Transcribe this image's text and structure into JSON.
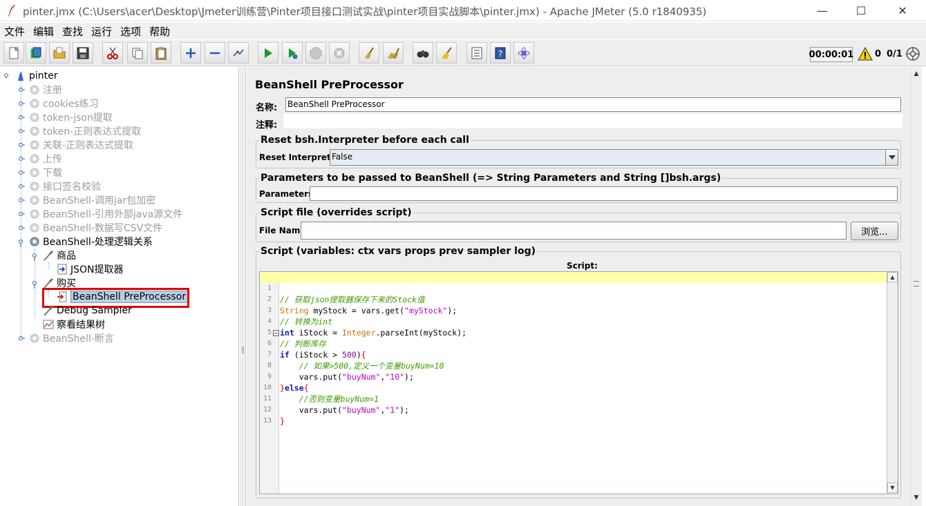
{
  "window": {
    "title": "pinter.jmx (C:\\Users\\acer\\Desktop\\Jmeter训练营\\Pinter项目接口测试实战\\pinter项目实战脚本\\pinter.jmx) - Apache JMeter (5.0 r1840935)",
    "minimize": "—",
    "maximize": "☐",
    "close": "✕"
  },
  "menu": [
    "文件",
    "编辑",
    "查找",
    "运行",
    "选项",
    "帮助"
  ],
  "toolbar": {
    "buttons": [
      "new-icon",
      "templates-icon",
      "open-icon",
      "save-icon",
      "cut-icon",
      "copy-icon",
      "paste-icon",
      "expand-icon",
      "collapse-icon",
      "toggle-icon",
      "start-icon",
      "start-no-pauses-icon",
      "stop-icon",
      "shutdown-icon",
      "clear-icon",
      "clear-all-icon",
      "search-icon",
      "reset-search-icon",
      "function-helper-icon",
      "help-icon",
      "log-viewer-icon"
    ],
    "timer": "00:00:01",
    "warnings": "0",
    "threads": "0/1"
  },
  "tree": {
    "root": "pinter",
    "items": [
      {
        "label": "注册",
        "disabled": true
      },
      {
        "label": "cookies练习",
        "disabled": true
      },
      {
        "label": "token-json提取",
        "disabled": true
      },
      {
        "label": "token-正则表达式提取",
        "disabled": true
      },
      {
        "label": "关联-正则表达式提取",
        "disabled": true
      },
      {
        "label": "上传",
        "disabled": true
      },
      {
        "label": "下载",
        "disabled": true
      },
      {
        "label": "接口签名校验",
        "disabled": true
      },
      {
        "label": "BeanShell-调用jar包加密",
        "disabled": true
      },
      {
        "label": "BeanShell-引用外部java源文件",
        "disabled": true
      },
      {
        "label": "BeanShell-数据写CSV文件",
        "disabled": true
      },
      {
        "label": "BeanShell-处理逻辑关系",
        "disabled": false
      },
      {
        "label": "商品",
        "disabled": false
      },
      {
        "label": "JSON提取器",
        "disabled": false
      },
      {
        "label": "购买",
        "disabled": false
      },
      {
        "label": "BeanShell PreProcessor",
        "disabled": false,
        "selected": true
      },
      {
        "label": "Debug Sampler",
        "disabled": false
      },
      {
        "label": "察看结果树",
        "disabled": false
      },
      {
        "label": "BeanShell-断言",
        "disabled": true
      }
    ]
  },
  "panel": {
    "title": "BeanShell PreProcessor",
    "name_label": "名称:",
    "name_value": "BeanShell PreProcessor",
    "comment_label": "注释:",
    "reset_legend": "Reset bsh.Interpreter before each call",
    "reset_label": "Reset Interpreter:",
    "reset_value": "False",
    "params_legend": "Parameters to be passed to BeanShell (=> String Parameters and String []bsh.args)",
    "params_label": "Parameters:",
    "params_value": "",
    "file_legend": "Script file (overrides script)",
    "file_label": "File Name:",
    "file_value": "",
    "browse_label": "浏览...",
    "script_legend": "Script (variables: ctx vars props prev sampler log)",
    "script_header": "Script:"
  },
  "script": {
    "line_numbers": [
      "1",
      "2",
      "3",
      "4",
      "5",
      "6",
      "7",
      "8",
      "9",
      "10",
      "11",
      "12",
      "13"
    ],
    "lines": [
      "// 获取json提取器保存下来的Stock值",
      "String myStock = vars.get(\"myStock\");",
      "// 转换为int",
      "int iStock = Integer.parseInt(myStock);",
      "// 判断库存",
      "if (iStock > 500){",
      "    // 如果>500,定义一个变量buyNum=10",
      "    vars.put(\"buyNum\",\"10\");",
      "}else{",
      "    //否则变量buyNum=1",
      "    vars.put(\"buyNum\",\"1\");",
      "}",
      ""
    ]
  },
  "colors": {
    "selection": "#b8cfe5",
    "highlight_box": "#e00000",
    "current_line": "#ffffa8",
    "comment": "#3f9a00",
    "string": "#c000c0"
  }
}
